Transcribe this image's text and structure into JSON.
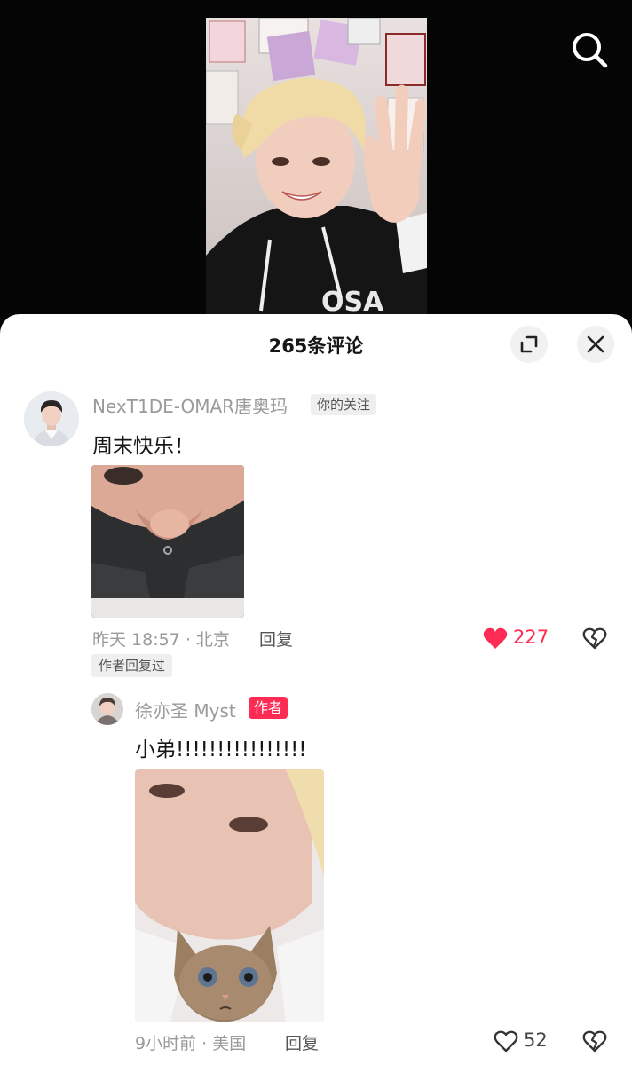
{
  "colors": {
    "accent": "#fe2c55",
    "text_primary": "#161616",
    "text_secondary": "#9a9a9a",
    "background": "#ffffff"
  },
  "icons": {
    "search": "search-icon",
    "expand": "expand-icon",
    "close": "close-icon",
    "like": "heart-icon",
    "dislike": "broken-heart-icon"
  },
  "panel": {
    "title": "265条评论"
  },
  "comments": [
    {
      "username": "NexT1DE-OMAR唐奥玛",
      "tag": "你的关注",
      "text": "周末快乐！",
      "time_location": "昨天 18:57 · 北京",
      "reply_label": "回复",
      "likes": "227",
      "liked": true,
      "badge": "作者回复过"
    },
    {
      "username": "徐亦圣 Myst",
      "tag": "作者",
      "text": "小弟!!!!!!!!!!!!!!!!",
      "time_location": "9小时前 · 美国",
      "reply_label": "回复",
      "likes": "52",
      "liked": false
    }
  ]
}
